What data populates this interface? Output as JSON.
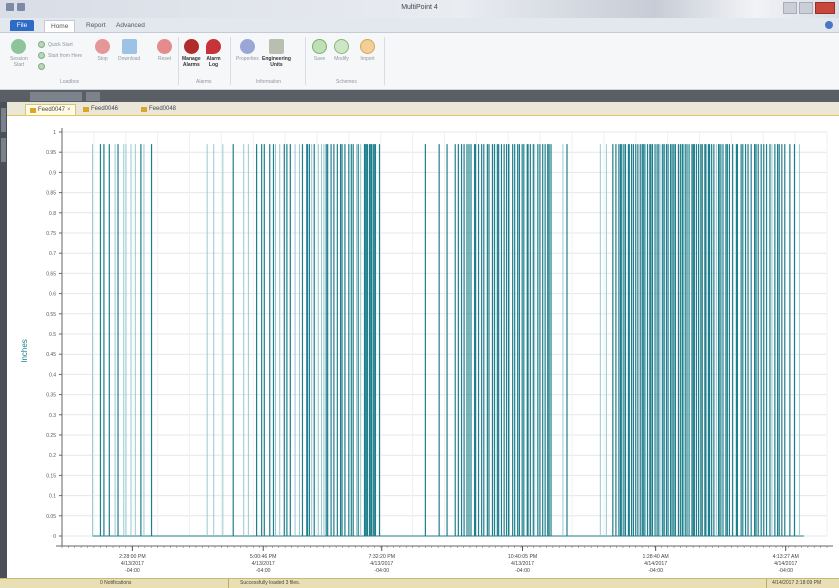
{
  "window": {
    "title": "MultiPoint 4"
  },
  "ribbon_tabs": [
    {
      "label": "File"
    },
    {
      "label": "Home"
    },
    {
      "label": "Report"
    },
    {
      "label": "Advanced"
    }
  ],
  "ribbon": {
    "groups": [
      {
        "label": "Loadbox"
      },
      {
        "label": "Alarms"
      },
      {
        "label": "Information"
      },
      {
        "label": "Schemes"
      }
    ],
    "buttons": {
      "session_start": "Session\nStart",
      "quick_start": "Quick Start",
      "start_from_here": "Start from Here",
      "stop": "Stop",
      "download": "Download",
      "reset": "Reset",
      "manage_alarms": "Manage\nAlarms",
      "alarm_log": "Alarm\nLog",
      "properties": "Properties",
      "engineering_units": "Engineering\nUnits",
      "save": "Save",
      "modify": "Modify",
      "import": "Import"
    }
  },
  "file_tabs": [
    {
      "label": "Feed0047"
    },
    {
      "label": "Feed0046"
    },
    {
      "label": "Feed0048"
    }
  ],
  "chart_data": {
    "type": "bar",
    "ylabel": "Inches",
    "ylim": [
      0,
      1
    ],
    "yticks": [
      "0",
      "0.05",
      "0.1",
      "0.15",
      "0.2",
      "0.25",
      "0.3",
      "0.35",
      "0.4",
      "0.45",
      "0.5",
      "0.55",
      "0.6",
      "0.65",
      "0.7",
      "0.75",
      "0.8",
      "0.85",
      "0.9",
      "0.95",
      "1"
    ],
    "xticks": [
      [
        "2:28:00 PM",
        "4/13/2017",
        "-04:00"
      ],
      [
        "5:00:46 PM",
        "4/13/2017",
        "-04:00"
      ],
      [
        "7:32:20 PM",
        "4/13/2017",
        "-04:00"
      ],
      [
        "10:40:05 PM",
        "4/13/2017",
        "-04:00"
      ],
      [
        "1:28:40 AM",
        "4/14/2017",
        "-04:00"
      ],
      [
        "4:13:27 AM",
        "4/14/2017",
        "-04:00"
      ]
    ],
    "xtick_fractions": [
      0.092,
      0.263,
      0.418,
      0.602,
      0.776,
      0.946
    ],
    "pulse_value": 0.97,
    "pulse_color": "#1f7e8c",
    "pulse_light_color": "#8cc3cb",
    "grid": true
  },
  "status": {
    "notifications": "0 Notifications",
    "message": "Successfully loaded 3 files.",
    "datetime": "4/14/2017 2:18:09 PM"
  }
}
